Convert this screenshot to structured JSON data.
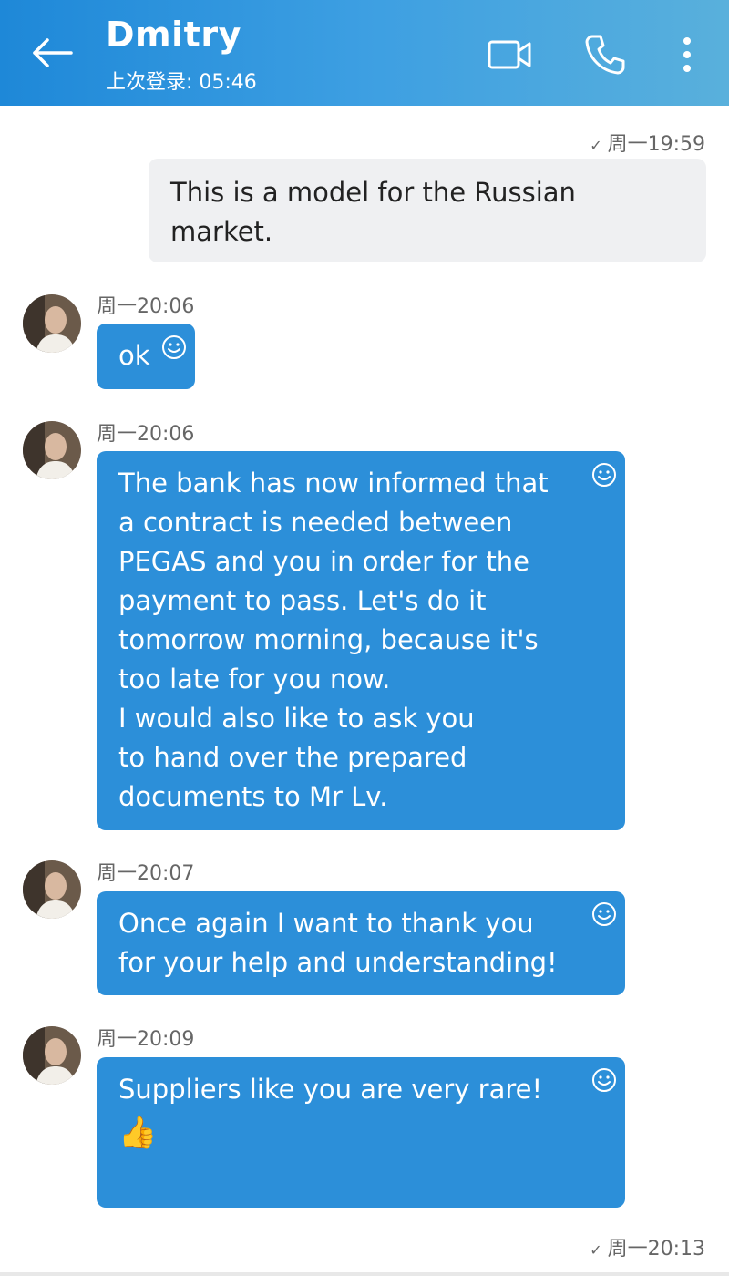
{
  "header": {
    "title": "Dmitry",
    "last_seen": "上次登录: 05:46",
    "icons": [
      "back-arrow-icon",
      "video-call-icon",
      "phone-icon",
      "more-vertical-icon"
    ]
  },
  "messages": [
    {
      "direction": "outgoing",
      "time": "周一19:59",
      "read_mark": "✓",
      "text": "This is a model for the Russian market."
    },
    {
      "direction": "incoming",
      "time": "周一20:06",
      "text": "ok"
    },
    {
      "direction": "incoming",
      "time": "周一20:06",
      "text": "The bank has now informed that\na contract is needed between\nPEGAS and you in order for the\npayment to pass. Let's do it\ntomorrow morning, because it's\ntoo late for you now.\nI would also like to ask you\nto hand over the prepared\ndocuments to Mr Lv."
    },
    {
      "direction": "incoming",
      "time": "周一20:07",
      "text": "Once again I want to thank you\nfor your help and understanding!"
    },
    {
      "direction": "incoming",
      "time": "周一20:09",
      "text": "Suppliers like you are very rare!",
      "emoji": "👍"
    },
    {
      "direction": "outgoing",
      "time": "周一20:13",
      "read_mark": "✓"
    }
  ],
  "colors": {
    "header_start": "#1e88d8",
    "header_end": "#59b0dc",
    "incoming_bubble": "#2c8fd9",
    "outgoing_bubble": "#eff0f2",
    "timestamp": "#666666"
  }
}
